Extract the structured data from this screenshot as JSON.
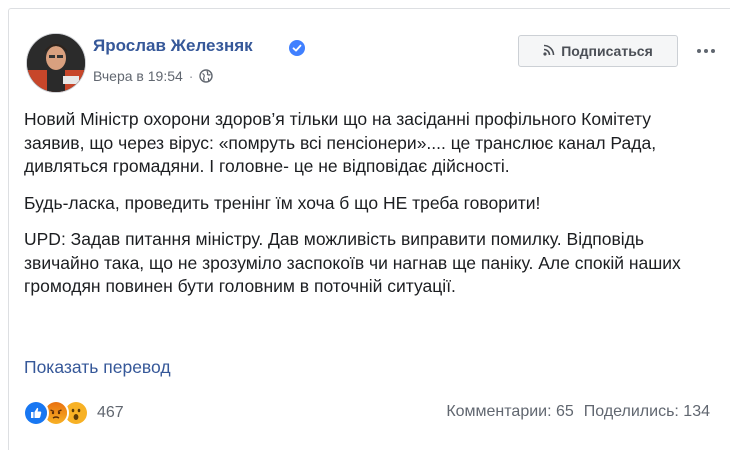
{
  "post": {
    "author": "Ярослав Железняк",
    "time": "Вчера в 19:54",
    "subscribe_label": "Подписаться",
    "paragraphs": [
      "Новий Міністр охорони здоров’я тільки що на засіданні профільного Комітету заявив, що через вірус: «помруть всі пенсіонери».... це транслює канал Рада, дивляться громадяни. І головне- це не відповідає дійсності.",
      "Будь-ласка, проведить тренінг їм хоча б що НЕ треба говорити!",
      "UPD: Задав питання міністру. Дав можливість виправити помилку. Відповідь звичайно така, що не зрозуміло заспокоїв чи нагнав ще паніку. Але спокій наших громодян повинен бути головним в поточній ситуації."
    ],
    "translate_label": "Показать перевод"
  },
  "footer": {
    "reaction_count": "467",
    "comments": "Комментарии: 65",
    "shares": "Поделились: 134"
  },
  "icons": {
    "verified": "verified-badge-icon",
    "globe": "globe-icon",
    "rss": "rss-icon",
    "more": "more-dots-icon",
    "reactions": [
      "like-reaction-icon",
      "angry-reaction-icon",
      "wow-reaction-icon"
    ]
  },
  "colors": {
    "link": "#365899",
    "meta": "#616770",
    "verified": "#4080ff",
    "like": "#1877f2",
    "angry": "#e9710f",
    "wow": "#f7b125"
  }
}
